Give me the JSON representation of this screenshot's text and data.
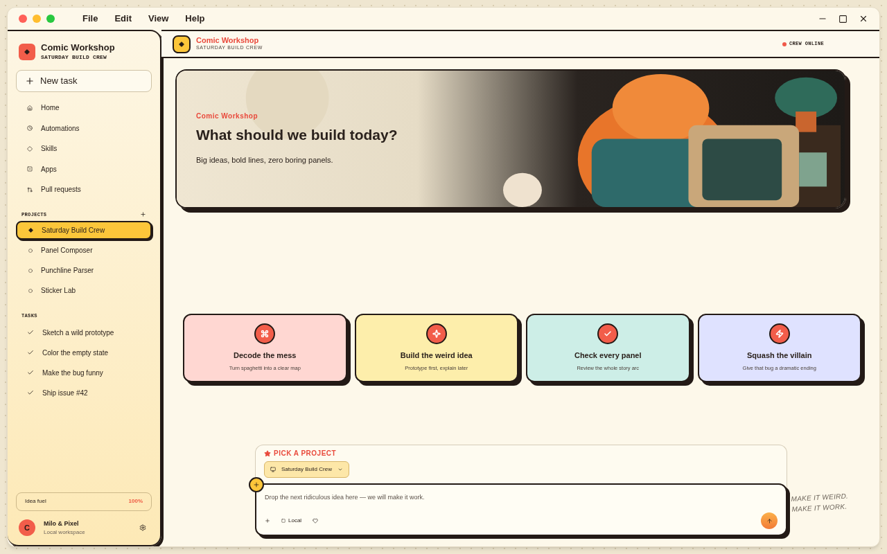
{
  "menu": [
    "File",
    "Edit",
    "View",
    "Help"
  ],
  "sidebar": {
    "brand": {
      "title": "Comic Workshop",
      "subtitle": "SATURDAY BUILD CREW"
    },
    "new_task": "New task",
    "nav": [
      {
        "label": "Home"
      },
      {
        "label": "Automations"
      },
      {
        "label": "Skills"
      },
      {
        "label": "Apps"
      },
      {
        "label": "Pull requests"
      }
    ],
    "projects_heading": "PROJECTS",
    "projects": [
      {
        "label": "Saturday Build Crew",
        "selected": true
      },
      {
        "label": "Panel Composer",
        "selected": false
      },
      {
        "label": "Punchline Parser",
        "selected": false
      },
      {
        "label": "Sticker Lab",
        "selected": false
      }
    ],
    "tasks_heading": "TASKS",
    "tasks": [
      {
        "label": "Sketch a wild prototype",
        "done": true
      },
      {
        "label": "Color the empty state",
        "done": true
      },
      {
        "label": "Make the bug funny",
        "done": true
      },
      {
        "label": "Ship issue #42",
        "done": true
      }
    ],
    "fuel": {
      "label": "Idea fuel",
      "value": "100%"
    },
    "user": {
      "avatar": "C",
      "name": "Milo & Pixel",
      "subtitle": "Local workspace"
    }
  },
  "header": {
    "title": "Comic Workshop",
    "subtitle": "SATURDAY BUILD CREW",
    "status": "CREW ONLINE",
    "online": true
  },
  "hero": {
    "eyebrow": "Comic Workshop",
    "heading": "What should we build today?",
    "text": "Big ideas, bold lines, zero boring panels.",
    "kind": "picture"
  },
  "cards": [
    {
      "title": "Decode the mess",
      "text": "Turn spaghetti into a clear map",
      "color": "#ffd7d2"
    },
    {
      "title": "Build the weird idea",
      "text": "Prototype first, explain later",
      "color": "#fdeeab"
    },
    {
      "title": "Check every panel",
      "text": "Review the whole story arc",
      "color": "#cdeee7"
    },
    {
      "title": "Squash the villain",
      "text": "Give that bug a dramatic ending",
      "color": "#dfe2ff"
    }
  ],
  "composer": {
    "label": "PICK A PROJECT",
    "project": "Saturday Build Crew",
    "placeholder": "Drop the next ridiculous idea here — we will make it work.",
    "mode": "Local"
  },
  "tagline": "MAKE IT WEIRD. MAKE IT WORK."
}
